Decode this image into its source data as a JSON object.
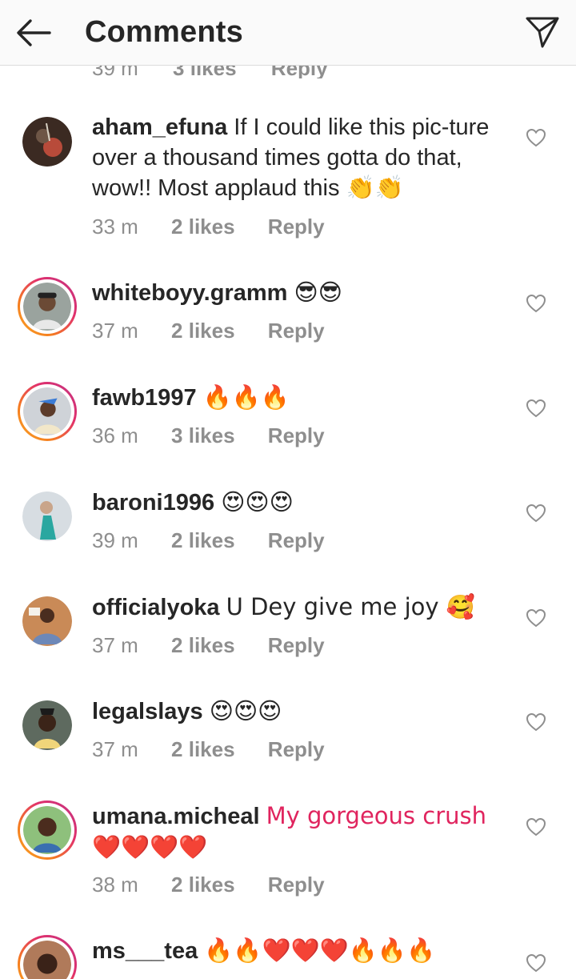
{
  "header": {
    "title": "Comments",
    "back_icon": "arrow-left-icon",
    "send_icon": "paper-plane-icon"
  },
  "partial_row": {
    "time": "39 m",
    "likes": "3 likes",
    "reply": "Reply"
  },
  "comments": [
    {
      "username": "aham_efuna",
      "text": "If I could like this pic-ture over a thousand times gotta do that, wow!! Most applaud this 👏👏",
      "time": "33 m",
      "likes": "2 likes",
      "reply": "Reply"
    },
    {
      "username": "whiteboyy.gramm",
      "text": "😎😎",
      "time": "37 m",
      "likes": "2 likes",
      "reply": "Reply"
    },
    {
      "username": "fawb1997",
      "text": "🔥🔥🔥",
      "time": "36 m",
      "likes": "3 likes",
      "reply": "Reply"
    },
    {
      "username": "baroni1996",
      "text": "😍😍😍",
      "time": "39 m",
      "likes": "2 likes",
      "reply": "Reply"
    },
    {
      "username": "officialyoka",
      "text": "U Dey give me joy 🥰",
      "time": "37 m",
      "likes": "2 likes",
      "reply": "Reply"
    },
    {
      "username": "legalslays",
      "text": "😍😍😍",
      "time": "37 m",
      "likes": "2 likes",
      "reply": "Reply"
    },
    {
      "username": "umana.micheal",
      "text": "My gorgeous crush ❤️❤️❤️❤️",
      "time": "38 m",
      "likes": "2 likes",
      "reply": "Reply"
    },
    {
      "username": "ms___tea",
      "text": "🔥🔥❤️❤️❤️🔥🔥🔥",
      "time": "",
      "likes": "",
      "reply": ""
    }
  ],
  "colors": {
    "text": "#262626",
    "meta": "#8e8e8e",
    "header_bg": "#fafafa",
    "story_ring": "#e1306c"
  }
}
